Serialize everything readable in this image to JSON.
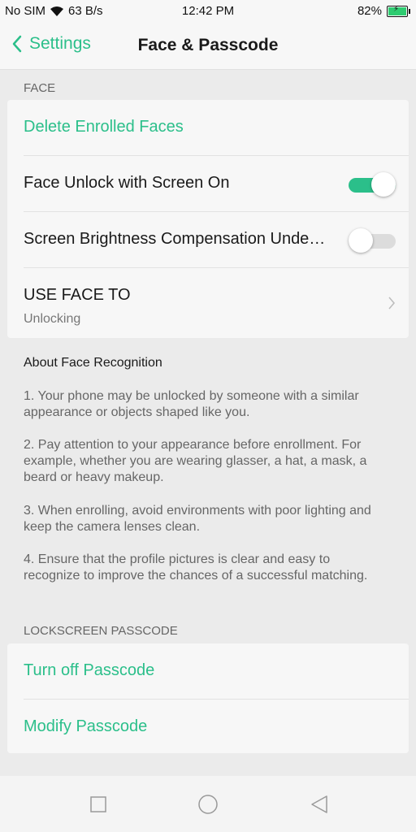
{
  "status_bar": {
    "carrier": "No SIM",
    "speed": "63 B/s",
    "time": "12:42 PM",
    "battery": "82%",
    "icons": [
      "wifi-icon",
      "battery-charging-icon"
    ]
  },
  "nav": {
    "back_label": "Settings",
    "title": "Face & Passcode"
  },
  "face_section": {
    "header": "FACE",
    "delete_label": "Delete Enrolled Faces",
    "face_unlock_label": "Face Unlock with Screen On",
    "face_unlock_on": true,
    "brightness_label": "Screen Brightness Compensation Unde…",
    "brightness_on": false,
    "use_face_label": "USE FACE TO",
    "use_face_value": "Unlocking"
  },
  "about": {
    "title": "About Face Recognition",
    "items": [
      "1. Your phone may be unlocked by someone with a similar appearance or objects shaped like you.",
      "2. Pay attention to your appearance before enrollment. For example, whether you are wearing glasser, a hat, a mask, a beard or heavy makeup.",
      "3. When enrolling, avoid environments with poor lighting and keep the camera lenses clean.",
      "4. Ensure that the profile pictures is clear and easy to recognize to improve the chances of a successful matching."
    ]
  },
  "passcode_section": {
    "header": "LOCKSCREEN PASSCODE",
    "turn_off_label": "Turn off Passcode",
    "modify_label": "Modify Passcode"
  },
  "colors": {
    "accent": "#2bbf8a",
    "background": "#ebebeb",
    "card": "#f7f7f7"
  },
  "bottom_nav": [
    "recents-square-icon",
    "home-circle-icon",
    "back-triangle-icon"
  ]
}
